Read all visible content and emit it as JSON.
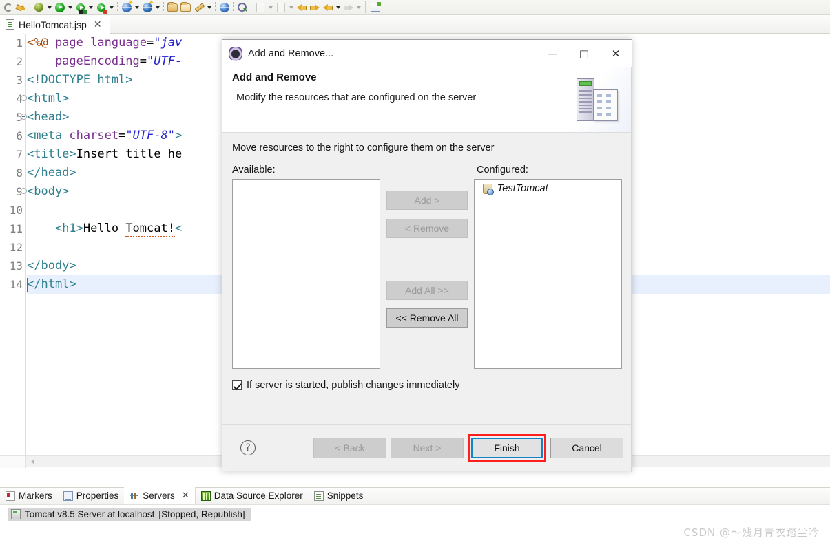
{
  "toolbar": {
    "items": [
      {
        "icon": "link-icon",
        "arrow": false
      },
      {
        "icon": "external-tools-icon",
        "arrow": false
      },
      {
        "icon": "debug-bug-icon",
        "arrow": true
      },
      {
        "icon": "run-icon",
        "arrow": true
      },
      {
        "icon": "run-server-icon",
        "arrow": true
      },
      {
        "icon": "run-stop-icon",
        "arrow": true
      },
      {
        "icon": "new-web-project-icon",
        "arrow": true
      },
      {
        "icon": "new-dynamic-project-icon",
        "arrow": true
      },
      {
        "icon": "open-folder-icon",
        "arrow": false
      },
      {
        "icon": "open-folder-alt-icon",
        "arrow": false
      },
      {
        "icon": "edit-pencil-icon",
        "arrow": true
      },
      {
        "icon": "browser-globe-icon",
        "arrow": false
      },
      {
        "icon": "search-run-icon",
        "arrow": false
      },
      {
        "icon": "document-export-icon",
        "arrow": true
      },
      {
        "icon": "document-import-icon",
        "arrow": true
      },
      {
        "icon": "back-star-icon",
        "arrow": false
      },
      {
        "icon": "forward-star-icon",
        "arrow": false
      },
      {
        "icon": "back-arrow-icon",
        "arrow": true
      },
      {
        "icon": "forward-arrow-grey-icon",
        "arrow": true
      },
      {
        "icon": "new-window-icon",
        "arrow": false
      }
    ]
  },
  "editor_tab": {
    "filename": "HelloTomcat.jsp",
    "close": "✕",
    "file_icon": "jsp-file-icon"
  },
  "code": {
    "lines": [
      {
        "num": "1",
        "fold": false,
        "highlight": false,
        "tokens": [
          {
            "t": "<%@ ",
            "c": "c-dir"
          },
          {
            "t": "page ",
            "c": "c-attr"
          },
          {
            "t": "language",
            "c": "c-attr"
          },
          {
            "t": "=",
            "c": "c-eq"
          },
          {
            "t": "\"jav",
            "c": "c-str"
          }
        ]
      },
      {
        "num": "2",
        "fold": false,
        "highlight": false,
        "tokens": [
          {
            "t": "    pageEncoding",
            "c": "c-attr"
          },
          {
            "t": "=",
            "c": "c-eq"
          },
          {
            "t": "\"UTF-",
            "c": "c-str"
          }
        ]
      },
      {
        "num": "3",
        "fold": false,
        "highlight": false,
        "tokens": [
          {
            "t": "<!DOCTYPE html>",
            "c": "c-tag"
          }
        ]
      },
      {
        "num": "4",
        "fold": true,
        "highlight": false,
        "tokens": [
          {
            "t": "<html>",
            "c": "c-tag"
          }
        ]
      },
      {
        "num": "5",
        "fold": true,
        "highlight": false,
        "tokens": [
          {
            "t": "<head>",
            "c": "c-tag"
          }
        ]
      },
      {
        "num": "6",
        "fold": false,
        "highlight": false,
        "tokens": [
          {
            "t": "<meta ",
            "c": "c-tag"
          },
          {
            "t": "charset",
            "c": "c-attr"
          },
          {
            "t": "=",
            "c": "c-eq"
          },
          {
            "t": "\"UTF-8\"",
            "c": "c-str"
          },
          {
            "t": ">",
            "c": "c-tag"
          }
        ]
      },
      {
        "num": "7",
        "fold": false,
        "highlight": false,
        "tokens": [
          {
            "t": "<title>",
            "c": "c-tag"
          },
          {
            "t": "Insert title he",
            "c": "c-txt"
          }
        ]
      },
      {
        "num": "8",
        "fold": false,
        "highlight": false,
        "tokens": [
          {
            "t": "</head>",
            "c": "c-tag"
          }
        ]
      },
      {
        "num": "9",
        "fold": true,
        "highlight": false,
        "tokens": [
          {
            "t": "<body>",
            "c": "c-tag"
          }
        ]
      },
      {
        "num": "10",
        "fold": false,
        "highlight": false,
        "tokens": []
      },
      {
        "num": "11",
        "fold": false,
        "highlight": false,
        "tokens": [
          {
            "t": "    <h1>",
            "c": "c-tag"
          },
          {
            "t": "Hello ",
            "c": "c-txt"
          },
          {
            "t": "Tomcat!",
            "c": "c-txt spell"
          },
          {
            "t": "<",
            "c": "c-tag"
          }
        ]
      },
      {
        "num": "12",
        "fold": false,
        "highlight": false,
        "tokens": []
      },
      {
        "num": "13",
        "fold": false,
        "highlight": false,
        "tokens": [
          {
            "t": "</body>",
            "c": "c-tag"
          }
        ]
      },
      {
        "num": "14",
        "fold": false,
        "highlight": true,
        "tokens": [
          {
            "t": "</html>",
            "c": "c-tag"
          }
        ]
      }
    ]
  },
  "dialog": {
    "title": "Add and Remove...",
    "title_icon": "settings-gear-icon",
    "minimize": "—",
    "maximize": "□",
    "close": "✕",
    "heading": "Add and Remove",
    "subheading": "Modify the resources that are configured on the server",
    "banner_icon": "server-and-document-icon",
    "intro": "Move resources to the right to configure them on the server",
    "available_label": "Available:",
    "configured_label": "Configured:",
    "available_items": [],
    "configured_items": [
      {
        "label": "TestTomcat",
        "icon": "web-module-icon"
      }
    ],
    "middle_buttons": [
      {
        "label": "Add >",
        "enabled": false
      },
      {
        "label": "< Remove",
        "enabled": false
      },
      {
        "label": "Add All >>",
        "enabled": false
      },
      {
        "label": "<< Remove All",
        "enabled": true
      }
    ],
    "checkbox": {
      "label": "If server is started, publish changes immediately",
      "checked": true
    },
    "help_icon": "?",
    "footer_buttons": [
      {
        "label": "< Back",
        "enabled": false,
        "focused": false,
        "highlighted": false
      },
      {
        "label": "Next >",
        "enabled": false,
        "focused": false,
        "highlighted": false
      },
      {
        "label": "Finish",
        "enabled": true,
        "focused": true,
        "highlighted": true
      },
      {
        "label": "Cancel",
        "enabled": true,
        "focused": false,
        "highlighted": false
      }
    ]
  },
  "view_tabs": [
    {
      "label": "Markers",
      "icon": "markers-icon",
      "active": false,
      "closable": false
    },
    {
      "label": "Properties",
      "icon": "properties-icon",
      "active": false,
      "closable": false
    },
    {
      "label": "Servers",
      "icon": "servers-icon",
      "active": true,
      "closable": true
    },
    {
      "label": "Data Source Explorer",
      "icon": "data-source-explorer-icon",
      "active": false,
      "closable": false
    },
    {
      "label": "Snippets",
      "icon": "snippets-icon",
      "active": false,
      "closable": false
    }
  ],
  "servers_view": {
    "server_name": "Tomcat v8.5 Server at localhost",
    "server_status": "[Stopped, Republish]",
    "icon": "tomcat-server-icon"
  },
  "watermark": "CSDN @～残月青衣踏尘吟",
  "colors": {
    "accent_blue": "#1383c8",
    "highlight_red": "#ff1f1f",
    "code_tag": "#2f7f8f",
    "code_attr": "#7b2f8f",
    "code_string": "#2222cc",
    "code_directive": "#9f4c10",
    "line_highlight": "#e8f0fe"
  }
}
